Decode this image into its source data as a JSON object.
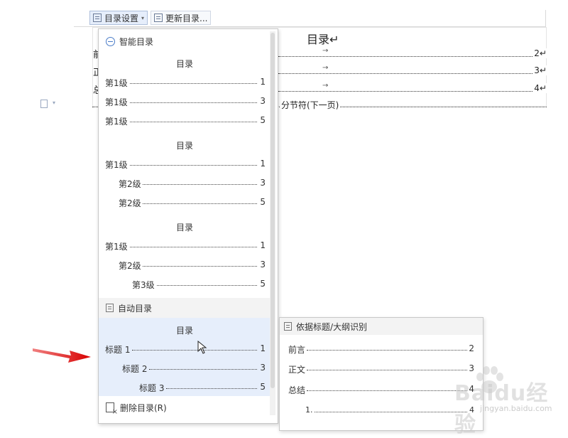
{
  "toolbar": {
    "toc_settings_label": "目录设置",
    "update_toc_label": "更新目录..."
  },
  "document": {
    "title": "目录↵",
    "left_chars": [
      "前",
      "正",
      "总"
    ],
    "lines": [
      {
        "arrow": "→",
        "page": "2↵"
      },
      {
        "arrow": "→",
        "page": "3↵"
      },
      {
        "arrow": "→",
        "page": "4↵"
      }
    ],
    "section_break": "分节符(下一页)"
  },
  "panel": {
    "smart_header": "智能目录",
    "styles": [
      {
        "title": "目录",
        "rows": [
          {
            "label": "第1级",
            "page": "1",
            "indent": 0
          },
          {
            "label": "第1级",
            "page": "3",
            "indent": 0
          },
          {
            "label": "第1级",
            "page": "5",
            "indent": 0
          }
        ]
      },
      {
        "title": "目录",
        "rows": [
          {
            "label": "第1级",
            "page": "1",
            "indent": 0
          },
          {
            "label": "第2级",
            "page": "3",
            "indent": 1
          },
          {
            "label": "第2级",
            "page": "5",
            "indent": 1
          }
        ]
      },
      {
        "title": "目录",
        "rows": [
          {
            "label": "第1级",
            "page": "1",
            "indent": 0
          },
          {
            "label": "第2级",
            "page": "3",
            "indent": 1
          },
          {
            "label": "第3级",
            "page": "5",
            "indent": 2
          }
        ]
      }
    ],
    "auto_header": "自动目录",
    "auto": {
      "title": "目录",
      "rows": [
        {
          "label": "标题 1",
          "page": "1",
          "indent": 0
        },
        {
          "label": "标题 2",
          "page": "3",
          "indent": 1
        },
        {
          "label": "标题 3",
          "page": "5",
          "indent": 2
        }
      ]
    },
    "delete_label": "删除目录(R)"
  },
  "submenu": {
    "header": "依据标题/大纲识别",
    "rows": [
      {
        "label": "前言",
        "page": "2"
      },
      {
        "label": "正文",
        "page": "3"
      },
      {
        "label": "总结",
        "page": "4"
      },
      {
        "label": "1.",
        "page": "4"
      }
    ]
  },
  "watermark": {
    "brand": "Baidu经验",
    "url": "jingyan.baidu.com"
  },
  "colors": {
    "highlight": "#e6eefb",
    "arrow_red": "#e02020",
    "accent_blue": "#4a7cc8"
  }
}
